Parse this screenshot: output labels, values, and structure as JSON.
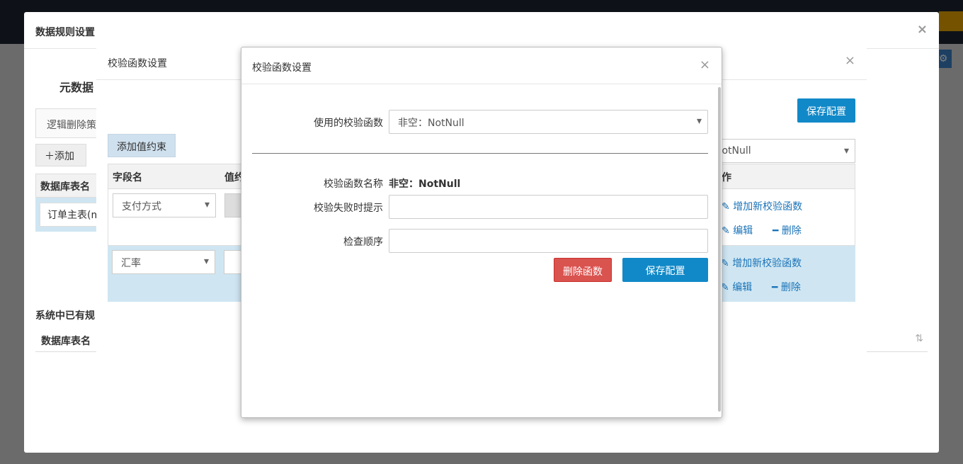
{
  "outer_dialog": {
    "title": "数据规则设置",
    "meta_title": "元数据",
    "strategy_tab": "逻辑删除策",
    "add_label": "添加",
    "table_header": "数据库表名",
    "row_value": "订单主表(m",
    "system_label": "系统中已有规",
    "list_header": "数据库表名"
  },
  "middle_dialog": {
    "title": "校验函数设置",
    "save_label": "保存配置",
    "add_constraint_label": "添加值约束",
    "top_select": "NotNull",
    "columns": {
      "field": "字段名",
      "value": "值约",
      "action": "作"
    },
    "rows": [
      {
        "field": "支付方式",
        "add": "增加新校验函数",
        "edit": "编辑",
        "delete": "删除"
      },
      {
        "field": "汇率",
        "add": "增加新校验函数",
        "edit": "编辑",
        "delete": "删除"
      }
    ],
    "row_delete": "删除"
  },
  "validation_dialog": {
    "title": "校验函数设置",
    "close": "×",
    "function_label": "使用的校验函数",
    "function_value": "非空：NotNull",
    "name_label": "校验函数名称",
    "name_value": "非空：NotNull",
    "fail_tip_label": "校验失败时提示",
    "fail_tip_value": "",
    "order_label": "检查顺序",
    "order_value": "",
    "delete_label": "删除函数",
    "save_label": "保存配置"
  },
  "colors": {
    "primary": "#1189c8",
    "danger": "#d9534f",
    "selected_row": "#cfe6f2"
  }
}
